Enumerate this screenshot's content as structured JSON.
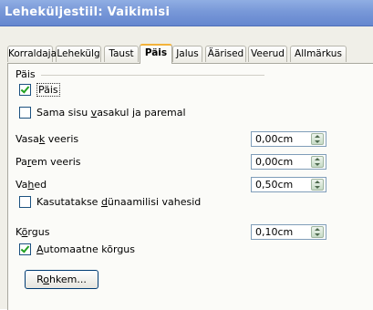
{
  "window": {
    "title": "Leheküljestiil: Vaikimisi"
  },
  "tabs": [
    "Korraldaja",
    "Lehekülg",
    "Taust",
    "Päis",
    "Jalus",
    "Äärised",
    "Veerud",
    "Allmärkus"
  ],
  "active_tab": "Päis",
  "section": {
    "title": "Päis"
  },
  "header_on": {
    "label": "Päis",
    "checked": true
  },
  "same_content": {
    "pre": "Sama sisu ",
    "key": "v",
    "post": "asakul ja paremal",
    "checked": false
  },
  "left_margin": {
    "pre": "Vasa",
    "key": "k",
    "post": " veeris",
    "value": "0,00cm"
  },
  "right_margin": {
    "pre": "Pa",
    "key": "r",
    "post": "em veeris",
    "value": "0,00cm"
  },
  "spacing": {
    "pre": "Va",
    "key": "h",
    "post": "ed",
    "value": "0,50cm"
  },
  "dynamic_spacing": {
    "pre": "Kasutatakse ",
    "key": "d",
    "post": "ünaamilisi vahesid",
    "checked": false
  },
  "height": {
    "pre": "K",
    "key": "õ",
    "post": "rgus",
    "value": "0,10cm"
  },
  "auto_height": {
    "pre": "",
    "key": "A",
    "post": "utomaatne kõrgus",
    "checked": true
  },
  "more_button": {
    "pre": "R",
    "key": "o",
    "post": "hkem..."
  }
}
